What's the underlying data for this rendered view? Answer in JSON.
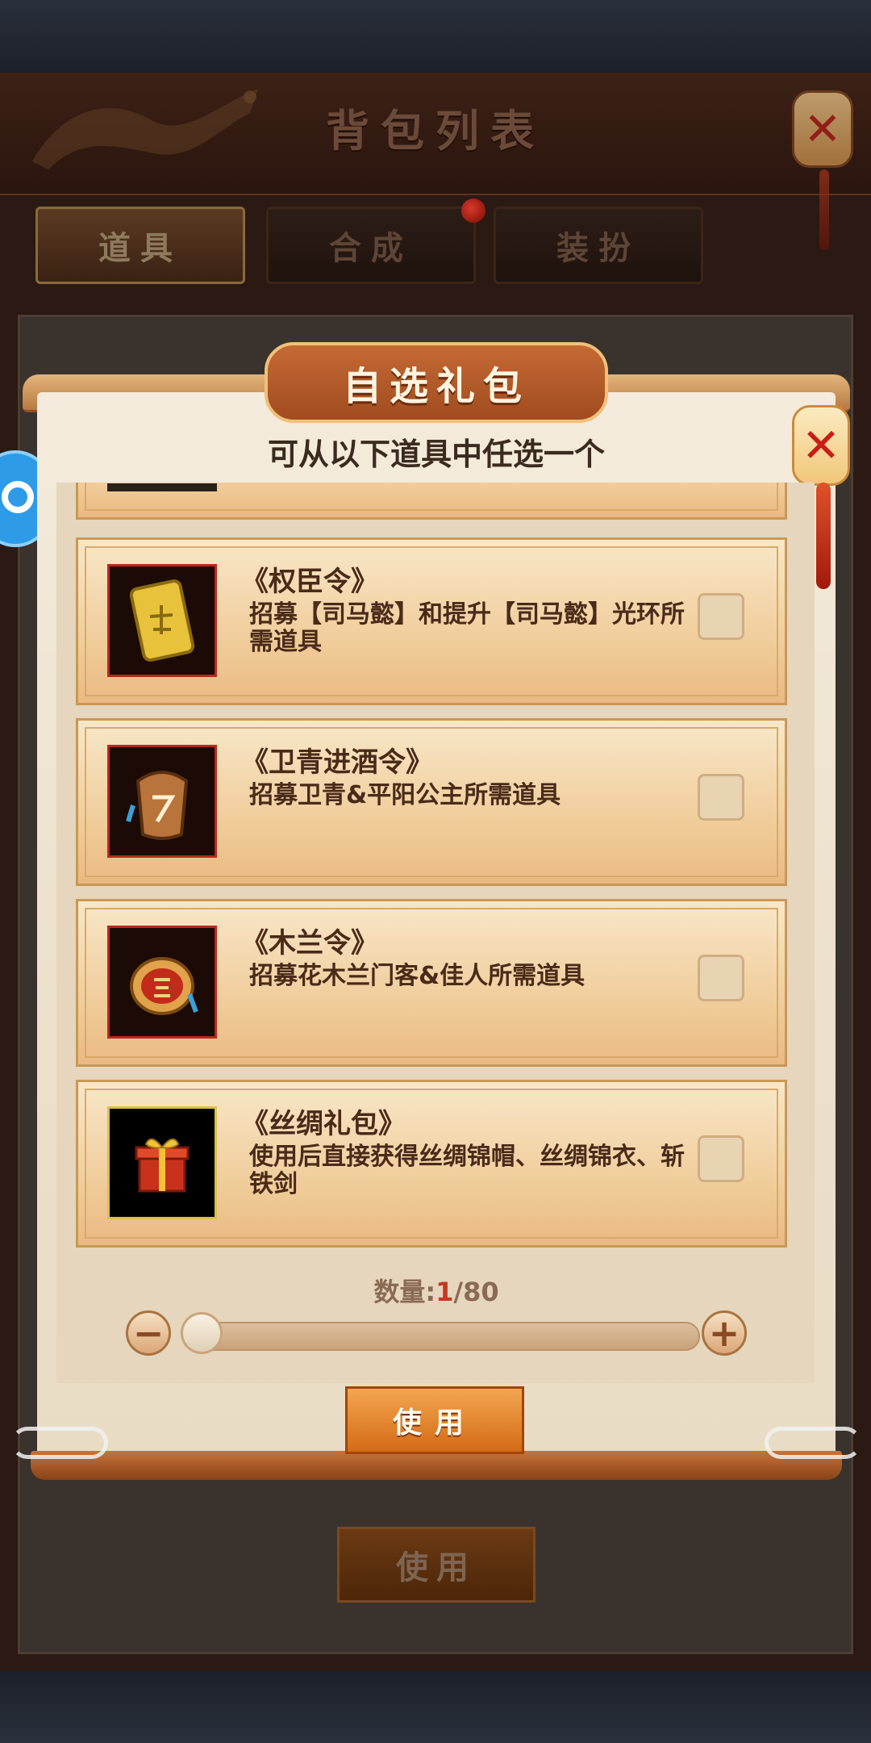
{
  "bag": {
    "title": "背包列表",
    "close_label": "✕",
    "tabs": [
      {
        "label": "道具",
        "active": true
      },
      {
        "label": "合成",
        "active": false
      },
      {
        "label": "装扮",
        "active": false
      }
    ],
    "use_label": "使用"
  },
  "dialog": {
    "title": "自选礼包",
    "subtitle": "可从以下道具中任选一个",
    "close_label": "✕",
    "items": [
      {
        "name": "《权臣令》",
        "desc": "招募【司马懿】和提升【司马懿】光环所需道具",
        "icon": "golden-token-icon",
        "checked": false
      },
      {
        "name": "《卫青进酒令》",
        "desc": "招募卫青&平阳公主所需道具",
        "icon": "bronze-token-icon",
        "checked": false
      },
      {
        "name": "《木兰令》",
        "desc": "招募花木兰门客&佳人所需道具",
        "icon": "red-token-icon",
        "checked": false
      },
      {
        "name": "《丝绸礼包》",
        "desc": "使用后直接获得丝绸锦帽、丝绸锦衣、斩铁剑",
        "icon": "gift-box-icon",
        "checked": false
      }
    ],
    "quantity": {
      "label": "数量:",
      "current": "1",
      "separator": "/",
      "max": "80",
      "minus_label": "−",
      "plus_label": "+"
    },
    "use_label": "使用"
  },
  "colors": {
    "accent_orange": "#d46a16",
    "card_bg": "#efc995",
    "text_dark": "#4a2a18",
    "quantity_current": "#c23a22"
  }
}
